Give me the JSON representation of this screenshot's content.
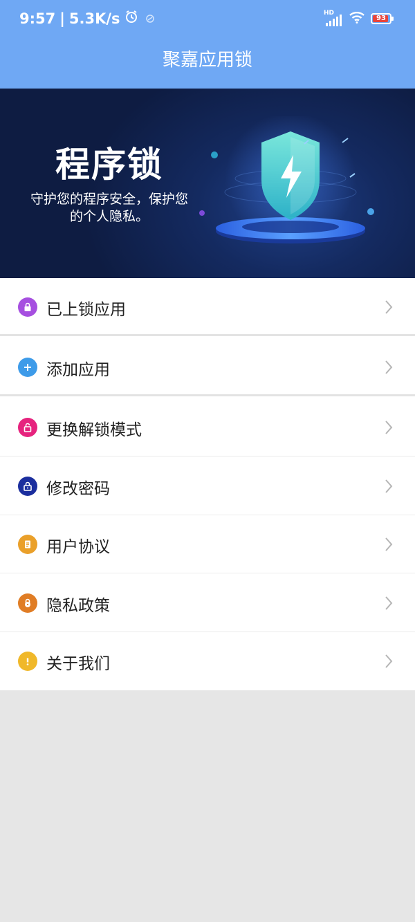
{
  "status": {
    "time": "9:57",
    "speed": "5.3K/s",
    "network_badge": "HD",
    "battery_level": "93",
    "battery_percent": 0.93
  },
  "header": {
    "title": "聚嘉应用锁"
  },
  "banner": {
    "title": "程序锁",
    "subtitle": "守护您的程序安全，保护您的个人隐私。"
  },
  "menu": {
    "items": [
      {
        "label": "已上锁应用",
        "icon": "lock-icon",
        "color": "#a64fe0"
      },
      {
        "label": "添加应用",
        "icon": "plus-icon",
        "color": "#3d9be9"
      },
      {
        "label": "更换解锁模式",
        "icon": "unlock-icon",
        "color": "#e6237e"
      },
      {
        "label": "修改密码",
        "icon": "password-lock-icon",
        "color": "#1b2e9e"
      },
      {
        "label": "用户协议",
        "icon": "document-icon",
        "color": "#eaa02a"
      },
      {
        "label": "隐私政策",
        "icon": "privacy-lock-icon",
        "color": "#e07d25"
      },
      {
        "label": "关于我们",
        "icon": "info-icon",
        "color": "#f0b82a"
      }
    ]
  },
  "colors": {
    "header": "#6fa8f4",
    "banner": "#142a60",
    "background": "#e6e6e6"
  }
}
